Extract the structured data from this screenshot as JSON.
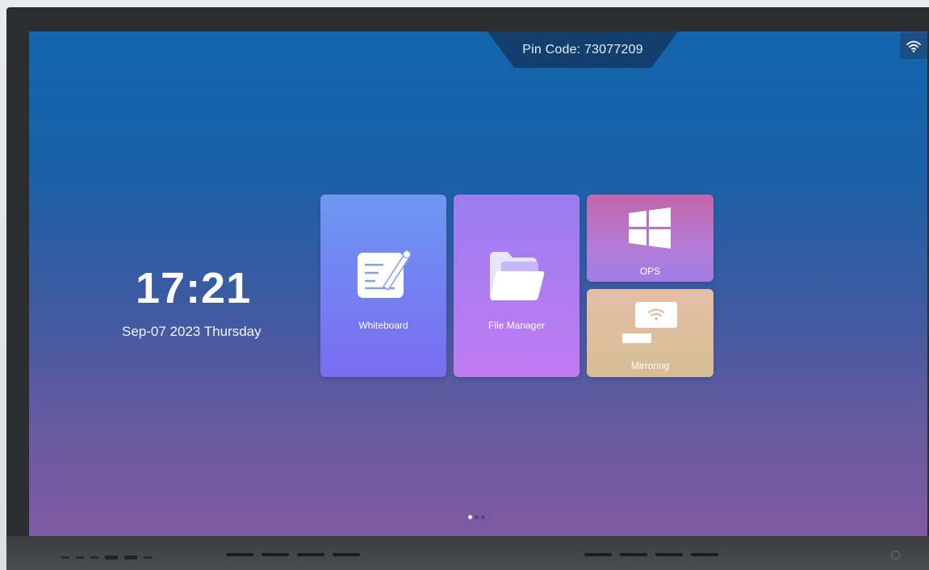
{
  "header": {
    "pin_code": "Pin Code: 73077209"
  },
  "status": {
    "wifi_icon": "wifi-icon"
  },
  "clock": {
    "time": "17:21",
    "date": "Sep-07 2023 Thursday"
  },
  "tiles": [
    {
      "label": "Whiteboard",
      "icon": "whiteboard-icon"
    },
    {
      "label": "File Manager",
      "icon": "folder-icon"
    },
    {
      "label": "OPS",
      "icon": "windows-icon"
    },
    {
      "label": "Mirroring",
      "icon": "screen-mirroring-icon"
    }
  ],
  "pagination": {
    "pages": 3,
    "current": 1
  },
  "colors": {
    "screen_top": "#1165ad",
    "screen_bottom": "#7f5aa3",
    "pin_tab": "#123f6d",
    "whiteboard_tile": "#7a6cf1",
    "file_manager_tile": "#c07bf0",
    "ops_tile": "#c266ab",
    "mirroring_tile": "#d7bd95"
  }
}
